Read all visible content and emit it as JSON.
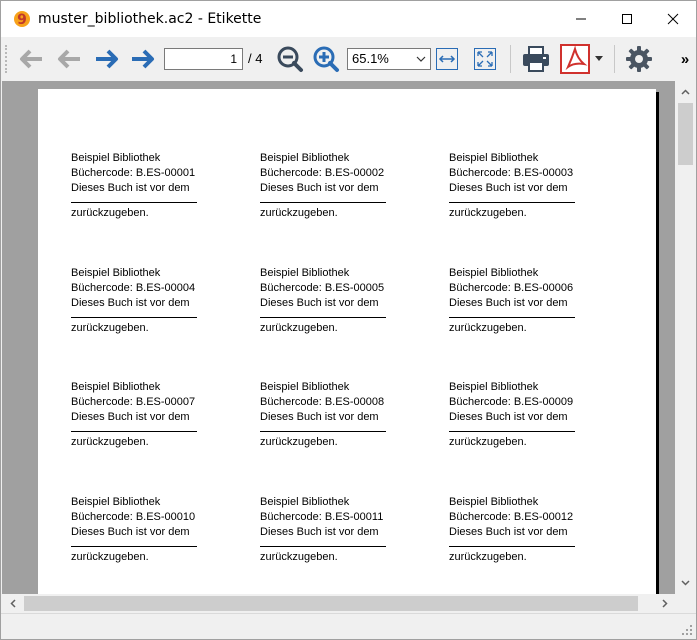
{
  "window": {
    "title": "muster_bibliothek.ac2 - Etikette"
  },
  "toolbar": {
    "first_icon": "double-arrow-left-icon",
    "prev_icon": "arrow-left-icon",
    "next_icon": "arrow-right-icon",
    "last_icon": "double-arrow-right-icon",
    "current_page": "1",
    "page_total": "/ 4",
    "zoom_value": "65.1%",
    "overflow": "»"
  },
  "colors": {
    "accent_blue": "#2a6cb5",
    "disabled_gray": "#a8a8a8",
    "pdf_red": "#d0312d",
    "viewer_bg": "#a0a0a0"
  },
  "labels": [
    {
      "org": "Beispiel Bibliothek",
      "code": "Büchercode: B.ES-00001",
      "text": "Dieses Buch ist vor dem",
      "tail": "zurückzugeben."
    },
    {
      "org": "Beispiel Bibliothek",
      "code": "Büchercode: B.ES-00002",
      "text": "Dieses Buch ist vor dem",
      "tail": "zurückzugeben."
    },
    {
      "org": "Beispiel Bibliothek",
      "code": "Büchercode: B.ES-00003",
      "text": "Dieses Buch ist vor dem",
      "tail": "zurückzugeben."
    },
    {
      "org": "Beispiel Bibliothek",
      "code": "Büchercode: B.ES-00004",
      "text": "Dieses Buch ist vor dem",
      "tail": "zurückzugeben."
    },
    {
      "org": "Beispiel Bibliothek",
      "code": "Büchercode: B.ES-00005",
      "text": "Dieses Buch ist vor dem",
      "tail": "zurückzugeben."
    },
    {
      "org": "Beispiel Bibliothek",
      "code": "Büchercode: B.ES-00006",
      "text": "Dieses Buch ist vor dem",
      "tail": "zurückzugeben."
    },
    {
      "org": "Beispiel Bibliothek",
      "code": "Büchercode: B.ES-00007",
      "text": "Dieses Buch ist vor dem",
      "tail": "zurückzugeben."
    },
    {
      "org": "Beispiel Bibliothek",
      "code": "Büchercode: B.ES-00008",
      "text": "Dieses Buch ist vor dem",
      "tail": "zurückzugeben."
    },
    {
      "org": "Beispiel Bibliothek",
      "code": "Büchercode: B.ES-00009",
      "text": "Dieses Buch ist vor dem",
      "tail": "zurückzugeben."
    },
    {
      "org": "Beispiel Bibliothek",
      "code": "Büchercode: B.ES-00010",
      "text": "Dieses Buch ist vor dem",
      "tail": "zurückzugeben."
    },
    {
      "org": "Beispiel Bibliothek",
      "code": "Büchercode: B.ES-00011",
      "text": "Dieses Buch ist vor dem",
      "tail": "zurückzugeben."
    },
    {
      "org": "Beispiel Bibliothek",
      "code": "Büchercode: B.ES-00012",
      "text": "Dieses Buch ist vor dem",
      "tail": "zurückzugeben."
    }
  ]
}
